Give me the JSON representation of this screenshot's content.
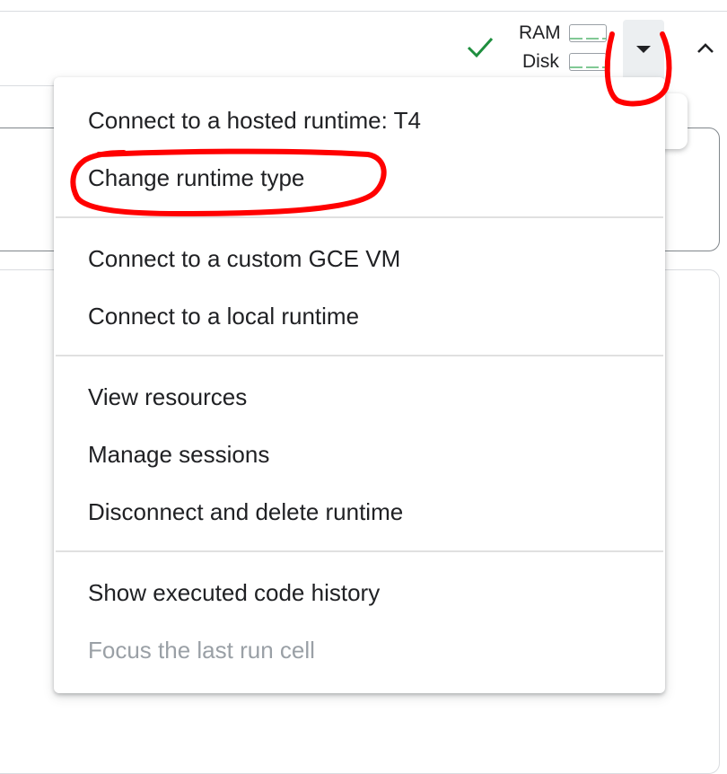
{
  "header": {
    "status_icon": "check-icon",
    "resources": {
      "ram_label": "RAM",
      "disk_label": "Disk"
    },
    "dropdown_icon": "caret-down-icon",
    "collapse_icon": "chevron-up-icon"
  },
  "menu": {
    "groups": [
      [
        "Connect to a hosted runtime: T4",
        "Change runtime type"
      ],
      [
        "Connect to a custom GCE VM",
        "Connect to a local runtime"
      ],
      [
        "View resources",
        "Manage sessions",
        "Disconnect and delete runtime"
      ],
      [
        "Show executed code history",
        "Focus the last run cell"
      ]
    ],
    "disabled_item": "Focus the last run cell"
  },
  "colors": {
    "annotation": "#ff0000",
    "check": "#1e8e3e",
    "disabled_text": "#9aa0a6"
  }
}
